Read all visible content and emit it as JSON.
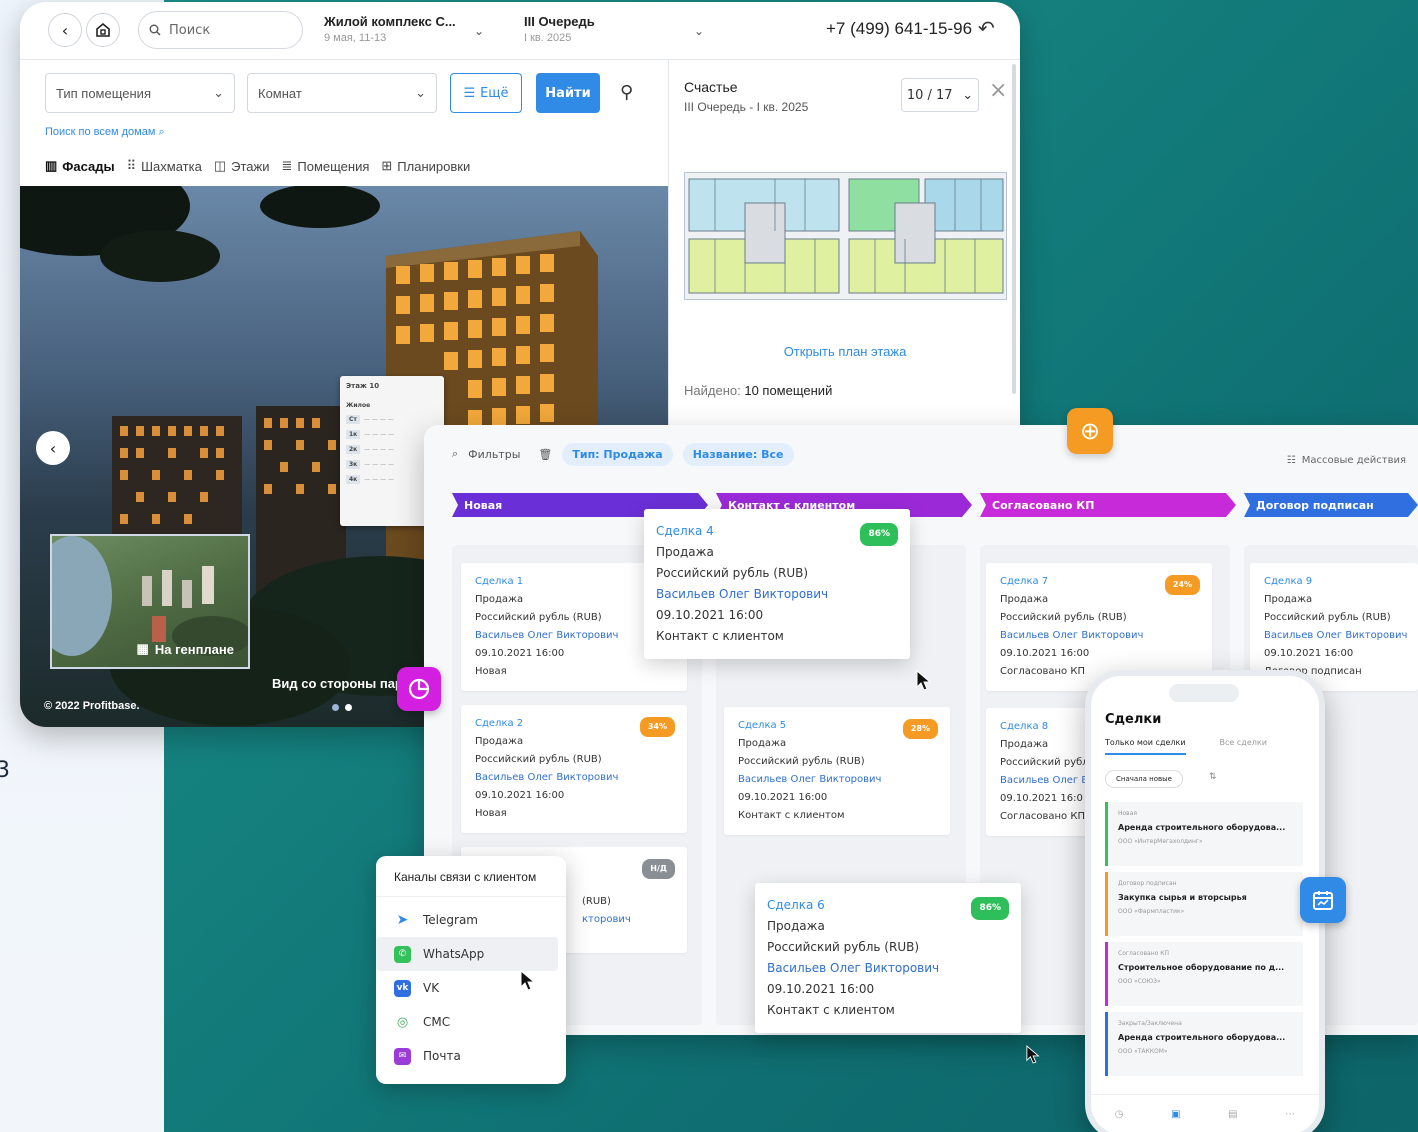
{
  "left_fragment": "3",
  "app": {
    "search_placeholder": "Поиск",
    "complex": {
      "name": "Жилой комплекс С...",
      "date": "9 мая, 11-13"
    },
    "queue": {
      "name": "III Очередь",
      "date": "I кв. 2025"
    },
    "phone": "+7 (499) 641-15-96"
  },
  "filters": {
    "room_type": "Тип помещения",
    "rooms": "Комнат",
    "more": "Ещё",
    "find": "Найти",
    "search_all": "Поиск по всем домам"
  },
  "views": [
    "Фасады",
    "Шахматка",
    "Этажи",
    "Помещения",
    "Планировки"
  ],
  "scene": {
    "floor_popup_title": "Этаж 10",
    "floor_popup_section": "Жилое",
    "floor_popup_rows": [
      "Ст",
      "1к",
      "2к",
      "3к",
      "4к"
    ],
    "genplan_label": "На генплане",
    "view_label": "Вид со стороны пар",
    "copyright": "© 2022 Profitbase."
  },
  "panel": {
    "title": "Счастье",
    "subtitle": "III Очередь - I кв. 2025",
    "floor_select": "10 / 17",
    "open_plan": "Открыть план этажа",
    "found_label": "Найдено:",
    "found_value": "10 помещений"
  },
  "crm": {
    "filters_label": "Фильтры",
    "tag_type": "Тип: Продажа",
    "tag_name": "Название: Все",
    "mass_actions": "Массовые действия",
    "stages": [
      {
        "label": "Новая",
        "color": "#6a2fd6"
      },
      {
        "label": "Контакт с клиентом",
        "color": "#9b29d8"
      },
      {
        "label": "Согласовано КП",
        "color": "#c72ad8"
      },
      {
        "label": "Договор подписан",
        "color": "#2f6fe0"
      }
    ],
    "cards": [
      {
        "name": "Сделка 1",
        "type": "Продажа",
        "currency": "Российский рубль (RUB)",
        "manager": "Васильев Олег Викторович",
        "date": "09.10.2021 16:00",
        "stage": "Новая",
        "badge": ""
      },
      {
        "name": "Сделка 2",
        "type": "Продажа",
        "currency": "Российский рубль (RUB)",
        "manager": "Васильев Олег Викторович",
        "date": "09.10.2021 16:00",
        "stage": "Новая",
        "badge": "34%"
      },
      {
        "name": "",
        "type": "",
        "currency": "(RUB)",
        "manager": "кторович",
        "date": "",
        "stage": "",
        "badge": "Н/Д"
      },
      {
        "name": "Сделка 5",
        "type": "Продажа",
        "currency": "Российский рубль (RUB)",
        "manager": "Васильев Олег Викторович",
        "date": "09.10.2021 16:00",
        "stage": "Контакт с клиентом",
        "badge": "28%"
      },
      {
        "name": "Сделка 7",
        "type": "Продажа",
        "currency": "Российский рубль (RUB)",
        "manager": "Васильев Олег Викторович",
        "date": "09.10.2021 16:00",
        "stage": "Согласовано КП",
        "badge": "24%"
      },
      {
        "name": "Сделка 8",
        "type": "Продажа",
        "currency": "Российский рубл",
        "manager": "Васильев Олег В",
        "date": "09.10.2021 16:0",
        "stage": "Согласовано КП",
        "badge": ""
      },
      {
        "name": "Сделка 9",
        "type": "Продажа",
        "currency": "Российский рубль (RUB)",
        "manager": "Васильев Олег Викторович",
        "date": "09.10.2021 16:00",
        "stage": "Договор подписан",
        "badge": ""
      }
    ],
    "big_cards": [
      {
        "name": "Сделка 4",
        "type": "Продажа",
        "currency": "Российский рубль (RUB)",
        "manager": "Васильев Олег Викторович",
        "date": "09.10.2021 16:00",
        "stage": "Контакт с клиентом",
        "badge": "86%"
      },
      {
        "name": "Сделка 6",
        "type": "Продажа",
        "currency": "Российский рубль (RUB)",
        "manager": "Васильев Олег Викторович",
        "date": "09.10.2021 16:00",
        "stage": "Контакт с клиентом",
        "badge": "86%"
      }
    ]
  },
  "channels": {
    "title": "Каналы связи с клиентом",
    "items": [
      {
        "label": "Telegram",
        "icon": "telegram-icon",
        "color": "#2f8be6"
      },
      {
        "label": "WhatsApp",
        "icon": "whatsapp-icon",
        "color": "#34c05a"
      },
      {
        "label": "VK",
        "icon": "vk-icon",
        "color": "#2f6fe0"
      },
      {
        "label": "СМС",
        "icon": "sms-icon",
        "color": "#3fae5e"
      },
      {
        "label": "Почта",
        "icon": "mail-icon",
        "color": "#9b3cd8"
      }
    ]
  },
  "mobile": {
    "title": "Сделки",
    "tab_mine": "Только мои сделки",
    "tab_all": "Все сделки",
    "sort": "Сначала новые",
    "items": [
      {
        "status": "Новая",
        "title": "Аренда строительного оборудова...",
        "company": "ООО «ИнтерМегахолдинг»",
        "color": "#34c05a"
      },
      {
        "status": "Договор подписан",
        "title": "Закупка сырья и вторсырья",
        "company": "ООО «Фармпластик»",
        "color": "#f59b23"
      },
      {
        "status": "Согласовано КП",
        "title": "Строительное оборудование по д...",
        "company": "ООО «СОЮЗ»",
        "color": "#c72ad8"
      },
      {
        "status": "Закрыта/Заключена",
        "title": "Аренда строительного оборудова...",
        "company": "ООО «ТАККОМ»",
        "color": "#2f6fe0"
      }
    ]
  }
}
